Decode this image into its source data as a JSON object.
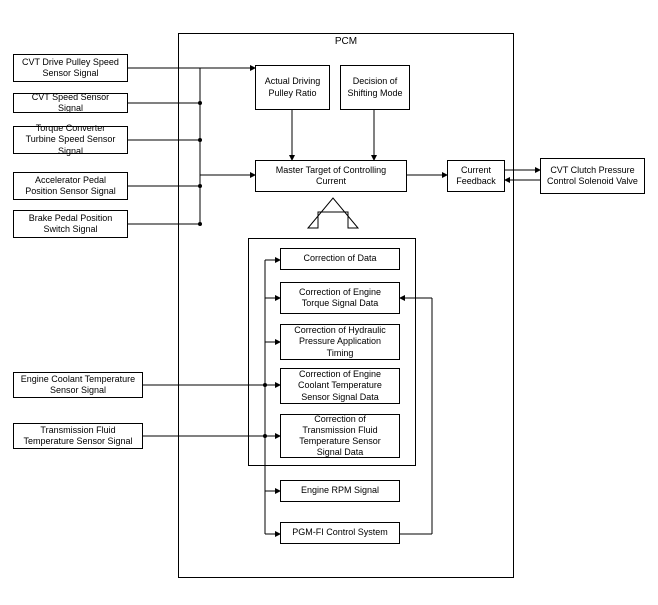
{
  "pcm_label": "PCM",
  "inputs": {
    "cvt_drive_pulley": "CVT Drive Pulley Speed Sensor Signal",
    "cvt_speed": "CVT Speed Sensor Signal",
    "torque_converter": "Torque Converter Turbine Speed Sensor Signal",
    "accelerator": "Accelerator Pedal Position Sensor Signal",
    "brake": "Brake Pedal Position Switch Signal",
    "engine_coolant": "Engine Coolant Temperature Sensor Signal",
    "trans_fluid": "Transmission Fluid Temperature Sensor Signal"
  },
  "pcm": {
    "actual_driving_ratio": "Actual Driving Pulley Ratio",
    "decision_shifting": "Decision of Shifting Mode",
    "master_target": "Master Target of Controlling Current",
    "current_feedback": "Current Feedback",
    "correction_data": "Correction of Data",
    "correction_torque": "Correction of Engine Torque Signal Data",
    "correction_hydraulic": "Correction of Hydraulic Pressure Application Timing",
    "correction_coolant": "Correction of Engine Coolant Temperature Sensor Signal Data",
    "correction_trans_fluid": "Correction of Transmission Fluid Temperature Sensor Signal Data",
    "engine_rpm": "Engine RPM Signal",
    "pgm_fi": "PGM-FI Control System"
  },
  "output": {
    "cvt_clutch_valve": "CVT Clutch Pressure Control Solenoid Valve"
  }
}
